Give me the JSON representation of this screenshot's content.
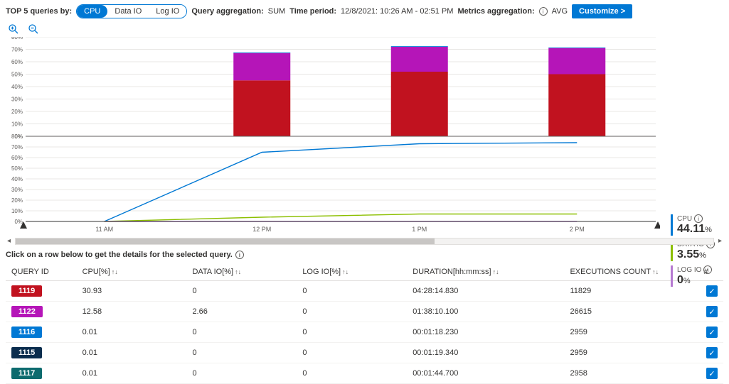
{
  "topbar": {
    "top5_label": "TOP 5 queries by:",
    "seg": {
      "cpu": "CPU",
      "dataio": "Data IO",
      "logio": "Log IO"
    },
    "qagg_label": "Query aggregation:",
    "qagg_value": "SUM",
    "time_label": "Time period:",
    "time_value": "12/8/2021: 10:26 AM - 02:51 PM",
    "magg_label": "Metrics aggregation:",
    "magg_value": "AVG",
    "customize": "Customize >"
  },
  "legend": {
    "cpu_name": "CPU",
    "cpu_val": "44.11",
    "cpu_pct": "%",
    "cpu_color": "#0078d4",
    "dio_name": "DATA IO",
    "dio_val": "3.55",
    "dio_pct": "%",
    "dio_color": "#8cbf00",
    "lio_name": "LOG IO",
    "lio_val": "0",
    "lio_pct": "%",
    "lio_color": "#b67ad1"
  },
  "instruction": "Click on a row below to get the details for the selected query.",
  "headers": {
    "id": "QUERY ID",
    "cpu": "CPU[%]",
    "dio": "DATA IO[%]",
    "lio": "LOG IO[%]",
    "dur": "DURATION[hh:mm:ss]",
    "exe": "EXECUTIONS COUNT",
    "sel": "#"
  },
  "rows": [
    {
      "id": "1119",
      "color": "#c1121f",
      "cpu": "30.93",
      "dio": "0",
      "lio": "0",
      "dur": "04:28:14.830",
      "exe": "11829"
    },
    {
      "id": "1122",
      "color": "#b515b8",
      "cpu": "12.58",
      "dio": "2.66",
      "lio": "0",
      "dur": "01:38:10.100",
      "exe": "26615"
    },
    {
      "id": "1116",
      "color": "#0078d4",
      "cpu": "0.01",
      "dio": "0",
      "lio": "0",
      "dur": "00:01:18.230",
      "exe": "2959"
    },
    {
      "id": "1115",
      "color": "#0b2d4e",
      "cpu": "0.01",
      "dio": "0",
      "lio": "0",
      "dur": "00:01:19.340",
      "exe": "2959"
    },
    {
      "id": "1117",
      "color": "#0d6b6e",
      "cpu": "0.01",
      "dio": "0",
      "lio": "0",
      "dur": "00:01:44.700",
      "exe": "2958"
    }
  ],
  "chart_data": [
    {
      "type": "bar",
      "stacked": true,
      "categories": [
        "11 AM",
        "12 PM",
        "1 PM",
        "2 PM"
      ],
      "ylabel": "",
      "xlabel": "",
      "ylim": [
        0,
        80
      ],
      "series": [
        {
          "name": "Query 1119",
          "color": "#c1121f",
          "values": [
            0,
            45,
            52,
            50
          ]
        },
        {
          "name": "Query 1122",
          "color": "#b515b8",
          "values": [
            0,
            22,
            20,
            21
          ]
        },
        {
          "name": "Query 1116",
          "color": "#0078d4",
          "values": [
            0,
            0.5,
            0.5,
            0.5
          ]
        }
      ]
    },
    {
      "type": "line",
      "x": [
        "11 AM",
        "12 PM",
        "1 PM",
        "2 PM"
      ],
      "ylabel": "",
      "xlabel": "",
      "ylim": [
        0,
        80
      ],
      "series": [
        {
          "name": "CPU",
          "color": "#0078d4",
          "values": [
            0,
            65,
            73,
            74
          ]
        },
        {
          "name": "DATA IO",
          "color": "#8cbf00",
          "values": [
            0,
            4,
            7,
            7
          ]
        },
        {
          "name": "LOG IO",
          "color": "#b67ad1",
          "values": [
            0,
            0,
            0,
            0
          ]
        }
      ]
    }
  ]
}
